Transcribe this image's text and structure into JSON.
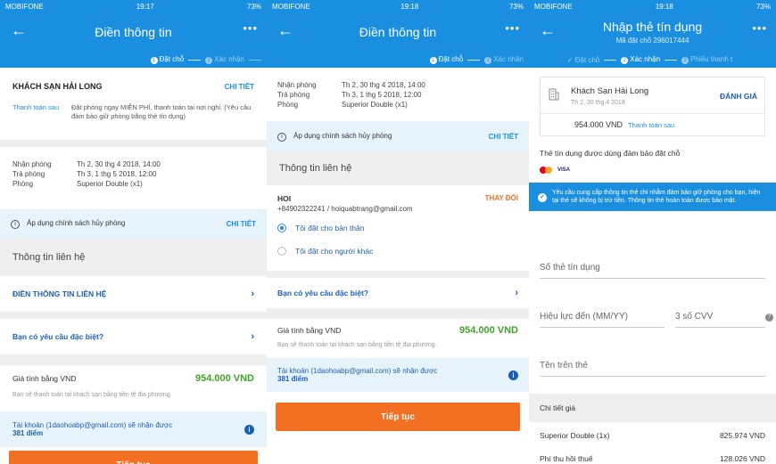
{
  "status": {
    "carrier": "MOBIFONE",
    "battery": "73%",
    "times": [
      "19:17",
      "19:18",
      "19:18"
    ]
  },
  "colors": {
    "brand_blue": "#1a8fe0",
    "cta_orange": "#f36f21",
    "price_green": "#43a02a",
    "link_blue": "#1a5fb4"
  },
  "screen1": {
    "title": "Điền thông tin",
    "steps": {
      "step1": "Đặt chỗ",
      "step2": "Xác nhận"
    },
    "hotel_name": "KHÁCH SẠN HẢI LONG",
    "detail_link": "CHI TIẾT",
    "pay_label": "Thanh toán sau",
    "pay_text": "Đặt phòng ngay MIỄN PHÍ, thanh toán tại nơi nghỉ. (Yêu cầu đảm bảo giữ phòng bằng thẻ tín dụng)",
    "checkin_label": "Nhận phòng",
    "checkin_value": "Th 2, 30 thg 4 2018, 14:00",
    "checkout_label": "Trả phòng",
    "checkout_value": "Th 3, 1 thg 5 2018, 12:00",
    "room_label": "Phòng",
    "room_value": "Superior Double (x1)",
    "policy_text": "Áp dụng chính sách hủy phòng",
    "policy_link": "CHI TIẾT",
    "contact_title": "Thông tin liên hệ",
    "contact_link": "ĐIỀN THÔNG TIN LIÊN HỆ",
    "special_request": "Bạn có yêu cầu đặc biệt?",
    "price_label": "Giá tính bằng VND",
    "price_value": "954.000 VND",
    "price_note": "Bạn sẽ thanh toán tại khách sạn bằng tiền tệ địa phương.",
    "points_text": "Tài khoản (1daohoabp@gmail.com) sẽ nhận được",
    "points_value": "381 điểm",
    "cta": "Tiếp tục"
  },
  "screen2": {
    "title": "Điền thông tin",
    "steps": {
      "step1": "Đặt chỗ",
      "step2": "Xác nhận"
    },
    "checkin_label": "Nhận phòng",
    "checkin_value": "Th 2, 30 thg 4 2018, 14:00",
    "checkout_label": "Trả phòng",
    "checkout_value": "Th 3, 1 thg 5 2018, 12:00",
    "room_label": "Phòng",
    "room_value": "Superior Double (x1)",
    "policy_text": "Áp dụng chính sách hủy phòng",
    "policy_link": "CHI TIẾT",
    "contact_title": "Thông tin liên hệ",
    "contact_name": "HOI",
    "contact_change": "THAY ĐỔI",
    "contact_info": "+84902322241 / hoiquabtrang@gmail.com",
    "radio_self": "Tôi đặt cho bản thân",
    "radio_other": "Tôi đặt cho người khác",
    "special_request": "Bạn có yêu cầu đặc biệt?",
    "price_label": "Giá tính bằng VND",
    "price_value": "954.000 VND",
    "price_note": "Bạn sẽ thanh toán tại khách sạn bằng tiền tệ địa phương.",
    "points_text": "Tài khoản (1daohoabp@gmail.com) sẽ nhận được",
    "points_value": "381 điểm",
    "cta": "Tiếp tục"
  },
  "screen3": {
    "title": "Nhập thẻ tín dụng",
    "subtitle": "Mã đặt chỗ 296017444",
    "steps": {
      "step1": "Đặt chỗ",
      "step2": "Xác nhận",
      "step3": "Phiếu thanh t"
    },
    "hotel_name": "Khách Sạn Hải Long",
    "hotel_date": "Th 2, 30 thg 4 2018",
    "rate_link": "ĐÁNH GIÁ",
    "price": "954.000 VND",
    "pay_later": "Thanh toán sau",
    "card_title": "Thẻ tín dụng được dùng đảm bảo đặt chỗ",
    "visa_label": "VISA",
    "secure_text": "Yêu cầu cung cấp thông tin thẻ chỉ nhằm đảm bảo giữ phòng cho bạn, hiện tại thẻ sẽ không bị trừ tiền. Thông tin thẻ hoàn toàn được bảo mật.",
    "card_number_placeholder": "Số thẻ tín dụng",
    "expiry_placeholder": "Hiệu lực đến (MM/YY)",
    "cvv_placeholder": "3 số CVV",
    "name_placeholder": "Tên trên thẻ",
    "detail_title": "Chi tiết giá",
    "line1_label": "Superior Double (1x)",
    "line1_value": "825.974 VND",
    "line2_label": "Phí thu hồi thuế",
    "line2_value": "128.026 VND"
  }
}
